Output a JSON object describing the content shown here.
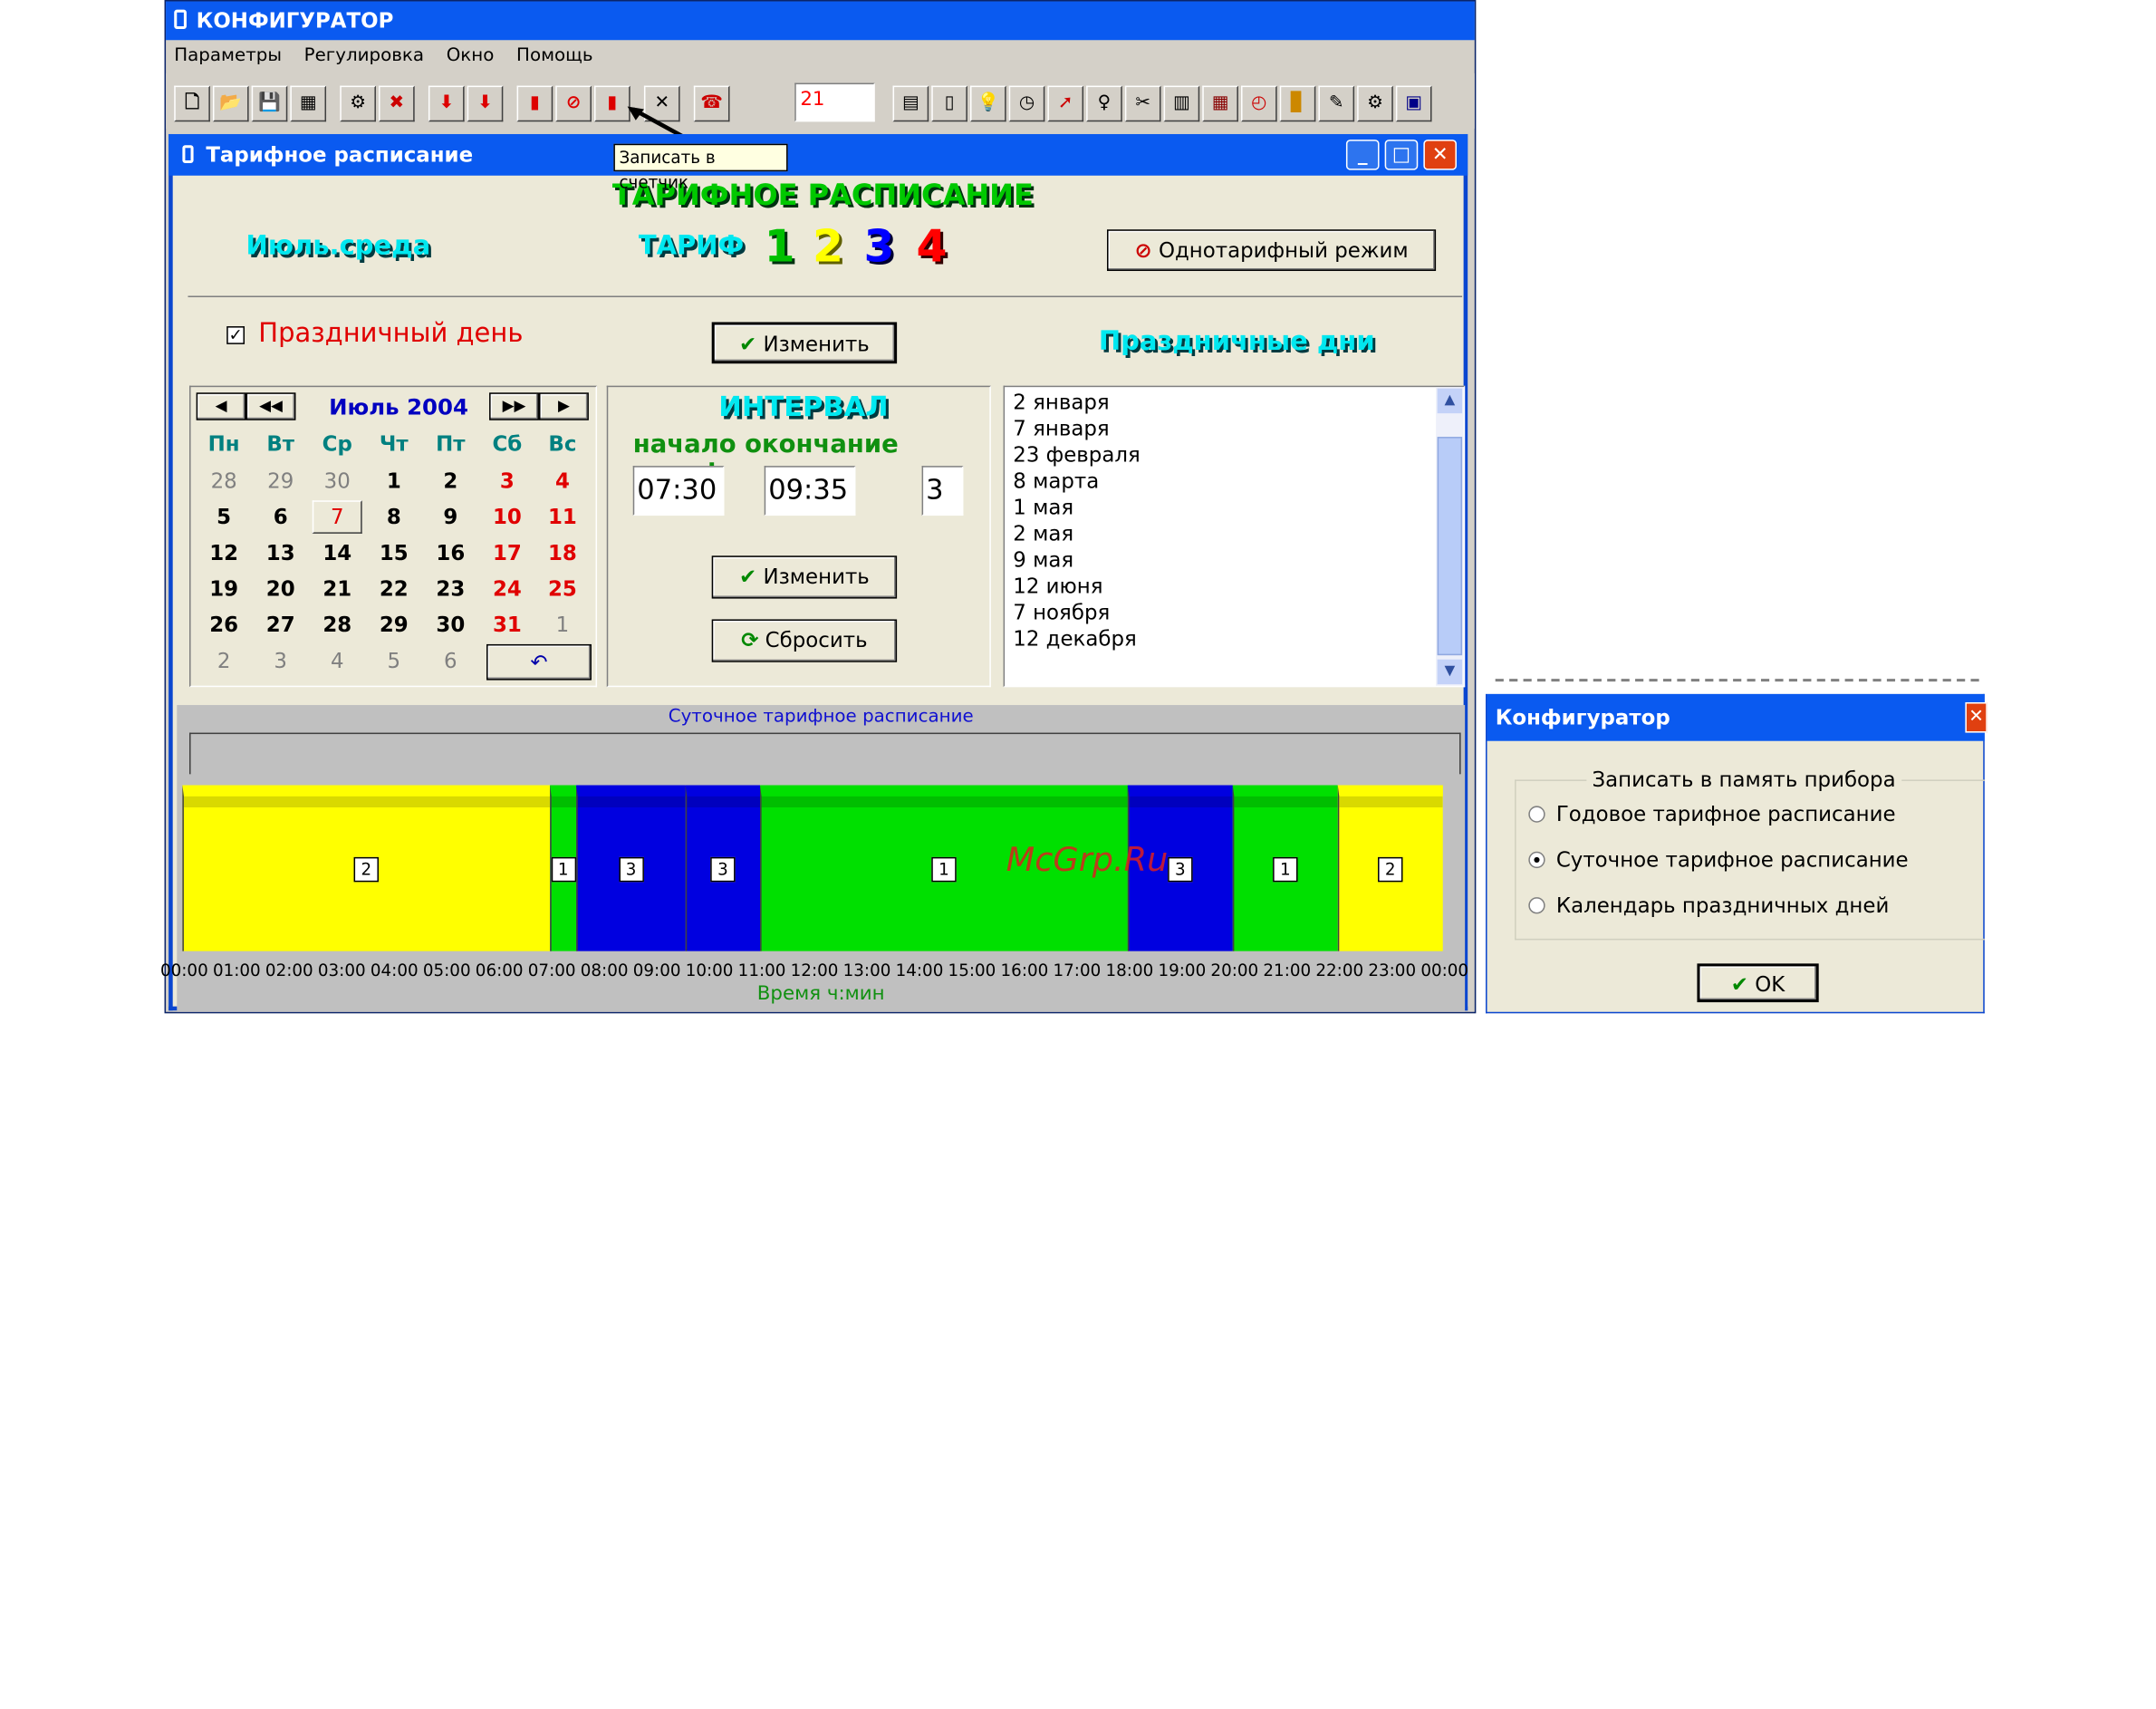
{
  "app": {
    "title": "КОНФИГУРАТОР",
    "menu": [
      "Параметры",
      "Регулировка",
      "Окно",
      "Помощь"
    ],
    "toolbar_value": "21",
    "tooltip": "Записать в счетчик"
  },
  "window": {
    "title": "Тарифное расписание",
    "heading": "ТАРИФНОЕ РАСПИСАНИЕ",
    "day_label": "Июль.среда",
    "tariff_label": "ТАРИФ",
    "tariff_numbers": [
      "1",
      "2",
      "3",
      "4"
    ],
    "tariff_colors": [
      "#00c000",
      "#ffff00",
      "#0000ff",
      "#ff0000"
    ],
    "single_tariff_button": "Однотарифный режим",
    "holiday_checkbox": "Праздничный день",
    "holiday_checked": true,
    "change_button": "Изменить",
    "holidays_title": "Праздничные дни"
  },
  "calendar": {
    "month": "Июль 2004",
    "weekdays": [
      "Пн",
      "Вт",
      "Ср",
      "Чт",
      "Пт",
      "Сб",
      "Вс"
    ],
    "rows": [
      [
        "28",
        "29",
        "30",
        "1",
        "2",
        "3",
        "4"
      ],
      [
        "5",
        "6",
        "7",
        "8",
        "9",
        "10",
        "11"
      ],
      [
        "12",
        "13",
        "14",
        "15",
        "16",
        "17",
        "18"
      ],
      [
        "19",
        "20",
        "21",
        "22",
        "23",
        "24",
        "25"
      ],
      [
        "26",
        "27",
        "28",
        "29",
        "30",
        "31",
        "1"
      ],
      [
        "2",
        "3",
        "4",
        "5",
        "6"
      ]
    ],
    "selected": "7"
  },
  "interval": {
    "title": "ИНТЕРВАЛ",
    "columns": "начало окончание тариф",
    "start": "07:30",
    "end": "09:35",
    "tariff": "3",
    "change_button": "Изменить",
    "reset_button": "Сбросить"
  },
  "holidays": [
    "2 января",
    "7 января",
    "23 февраля",
    "8 марта",
    "1 мая",
    "2 мая",
    "9 мая",
    "12 июня",
    "7 ноября",
    "12 декабря"
  ],
  "chart_data": {
    "type": "bar",
    "title": "Суточное тарифное расписание",
    "xlabel": "Время ч:мин",
    "x_ticks": [
      "00:00",
      "01:00",
      "02:00",
      "03:00",
      "04:00",
      "05:00",
      "06:00",
      "07:00",
      "08:00",
      "09:00",
      "10:00",
      "11:00",
      "12:00",
      "13:00",
      "14:00",
      "15:00",
      "16:00",
      "17:00",
      "18:00",
      "19:00",
      "20:00",
      "21:00",
      "22:00",
      "23:00",
      "00:00"
    ],
    "segments": [
      {
        "start": "00:00",
        "end": "07:00",
        "tariff": 2
      },
      {
        "start": "07:00",
        "end": "07:30",
        "tariff": 1
      },
      {
        "start": "07:30",
        "end": "09:35",
        "tariff": 3
      },
      {
        "start": "09:35",
        "end": "11:00",
        "tariff": 3
      },
      {
        "start": "11:00",
        "end": "18:00",
        "tariff": 1
      },
      {
        "start": "18:00",
        "end": "20:00",
        "tariff": 3
      },
      {
        "start": "20:00",
        "end": "22:00",
        "tariff": 1
      },
      {
        "start": "22:00",
        "end": "24:00",
        "tariff": 2
      }
    ]
  },
  "watermark": "McGrp.Ru",
  "dialog": {
    "title": "Конфигуратор",
    "group": "Записать в память прибора",
    "options": [
      "Годовое тарифное расписание",
      "Суточное тарифное расписание",
      "Календарь праздничных дней"
    ],
    "selected": 1,
    "ok": "OK"
  }
}
